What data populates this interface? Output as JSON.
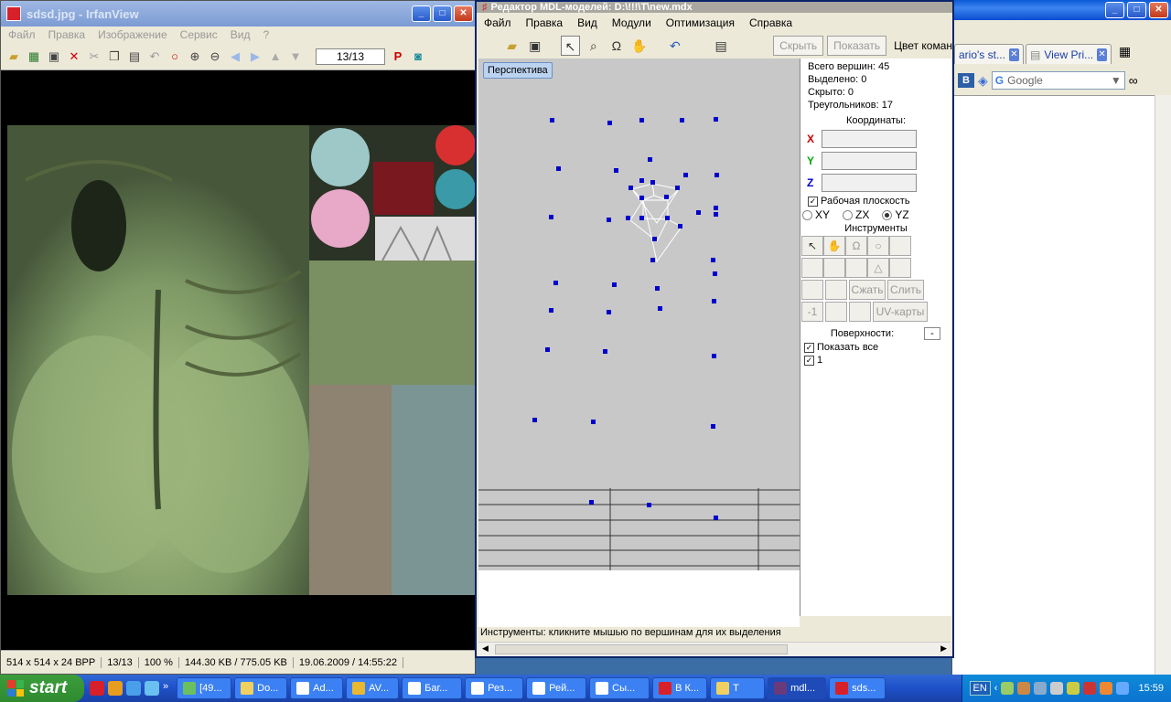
{
  "browser": {
    "tabs": [
      {
        "label": "ario's st..."
      },
      {
        "label": "View Pri..."
      }
    ],
    "vk_label": "B",
    "search_placeholder": "Google"
  },
  "irfan": {
    "title": "sdsd.jpg - IrfanView",
    "menu": [
      "Файл",
      "Правка",
      "Изображение",
      "Сервис",
      "Вид",
      "?"
    ],
    "counter": "13/13",
    "status": {
      "dims": "514 x 514 x 24 BPP",
      "index": "13/13",
      "zoom": "100 %",
      "size": "144.30 KB / 775.05 KB",
      "date": "19.06.2009 / 14:55:22"
    }
  },
  "mdl": {
    "title": "Редактор MDL-моделей: D:\\!!!\\T\\new.mdx",
    "menu": [
      "Файл",
      "Правка",
      "Вид",
      "Модули",
      "Оптимизация",
      "Справка"
    ],
    "hide_label": "Скрыть",
    "show_label": "Показать",
    "color_label": "Цвет коман",
    "viewport_label": "Перспектива",
    "stats": {
      "vertices": "Всего вершин: 45",
      "selected": "Выделено: 0",
      "hidden": "Скрыто: 0",
      "triangles": "Треугольников: 17"
    },
    "coords_title": "Координаты:",
    "axis_x": "X",
    "axis_y": "Y",
    "axis_z": "Z",
    "work_plane": "Рабочая плоскость",
    "planes": [
      "XY",
      "ZX",
      "YZ"
    ],
    "tools_title": "Инструменты",
    "compress_label": "Сжать",
    "merge_label": "Слить",
    "minus_one": "-1",
    "uv_label": "UV-карты",
    "surfaces_title": "Поверхности:",
    "surfaces_minus": "-",
    "show_all": "Показать все",
    "surface_1": "1",
    "status_text": "Инструменты: кликните мышью по вершинам для их выделения"
  },
  "taskbar": {
    "start": "start",
    "tasks": [
      "[49...",
      "Do...",
      "Ad...",
      "AV...",
      "Баг...",
      "Рез...",
      "Рей...",
      "Сы...",
      "В К...",
      "T",
      "mdl...",
      "sds..."
    ],
    "lang": "EN",
    "clock": "15:59"
  },
  "colors": {
    "vertex": "#0000cc",
    "texture_green": "#7f9a66",
    "taskbar_blue": "#245edb"
  }
}
